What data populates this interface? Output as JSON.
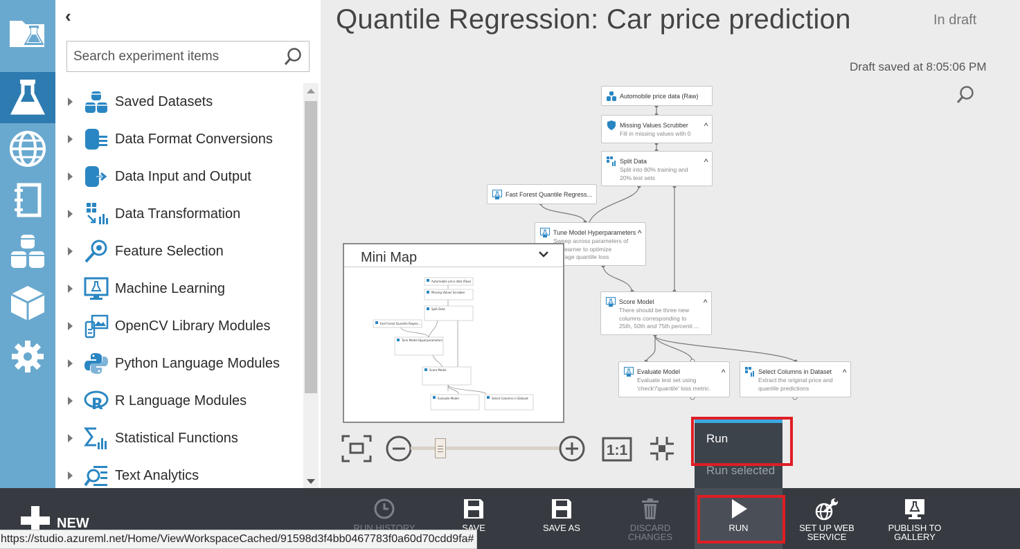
{
  "experiment": {
    "title": "Quantile Regression: Car price prediction",
    "status": "In draft",
    "saved_text": "Draft saved at 8:05:06 PM"
  },
  "sidebar": {
    "items": [
      {
        "icon": "projects-icon"
      },
      {
        "icon": "experiments-icon",
        "active": true
      },
      {
        "icon": "web-services-icon"
      },
      {
        "icon": "notebooks-icon"
      },
      {
        "icon": "datasets-icon"
      },
      {
        "icon": "trained-models-icon"
      },
      {
        "icon": "settings-icon"
      }
    ]
  },
  "palette": {
    "search_placeholder": "Search experiment items",
    "categories": [
      {
        "label": "Saved Datasets",
        "icon": "saved-datasets-icon"
      },
      {
        "label": "Data Format Conversions",
        "icon": "data-format-icon"
      },
      {
        "label": "Data Input and Output",
        "icon": "data-io-icon"
      },
      {
        "label": "Data Transformation",
        "icon": "data-transformation-icon"
      },
      {
        "label": "Feature Selection",
        "icon": "feature-selection-icon"
      },
      {
        "label": "Machine Learning",
        "icon": "machine-learning-icon"
      },
      {
        "label": "OpenCV Library Modules",
        "icon": "opencv-icon"
      },
      {
        "label": "Python Language Modules",
        "icon": "python-icon"
      },
      {
        "label": "R Language Modules",
        "icon": "r-language-icon"
      },
      {
        "label": "Statistical Functions",
        "icon": "statistical-icon"
      },
      {
        "label": "Text Analytics",
        "icon": "text-analytics-icon"
      }
    ]
  },
  "nodes": {
    "n1": {
      "title": "Automobile price data (Raw)",
      "desc": ""
    },
    "n2": {
      "title": "Missing Values Scrubber",
      "desc": "Fill in missing values with 0"
    },
    "n3": {
      "title": "Split Data",
      "desc": "Split into 80% training and 20% test sets"
    },
    "n4": {
      "title": "Fast Forest Quantile Regress...",
      "desc": ""
    },
    "n5": {
      "title": "Tune Model Hyperparameters",
      "desc": "Sweep across parameters of the learner to optimize average quantile loss"
    },
    "n6": {
      "title": "Score Model",
      "desc": "There should be three new columns corresponding to 25th, 50th and 75th percenti ..."
    },
    "n7": {
      "title": "Evaluate Model",
      "desc": "Evaluate test set using 'check'/'quantile' loss metric."
    },
    "n8": {
      "title": "Select Columns in Dataset",
      "desc": "Extract the original price and quantile predictions"
    }
  },
  "minimap": {
    "title": "Mini Map"
  },
  "zoom": {
    "actual_size_label": "1:1",
    "level": 0.2
  },
  "run_menu": {
    "items": [
      "Run",
      "Run selected"
    ]
  },
  "commands": {
    "new": "NEW",
    "run_history": "RUN HISTORY",
    "save": "SAVE",
    "save_as": "SAVE AS",
    "discard": "DISCARD CHANGES",
    "run": "RUN",
    "setup_ws": "SET UP WEB SERVICE",
    "publish": "PUBLISH TO GALLERY"
  },
  "status_url": "https://studio.azureml.net/Home/ViewWorkspaceCached/91598d3f4bb0467783f0a60d70cdd9fa#",
  "colors": {
    "rail": "#6aa9cf",
    "rail_active": "#2d7bb0",
    "command_bar": "#373b41",
    "highlight": "#e01d24",
    "menu_stripe": "#3ba7e0"
  }
}
